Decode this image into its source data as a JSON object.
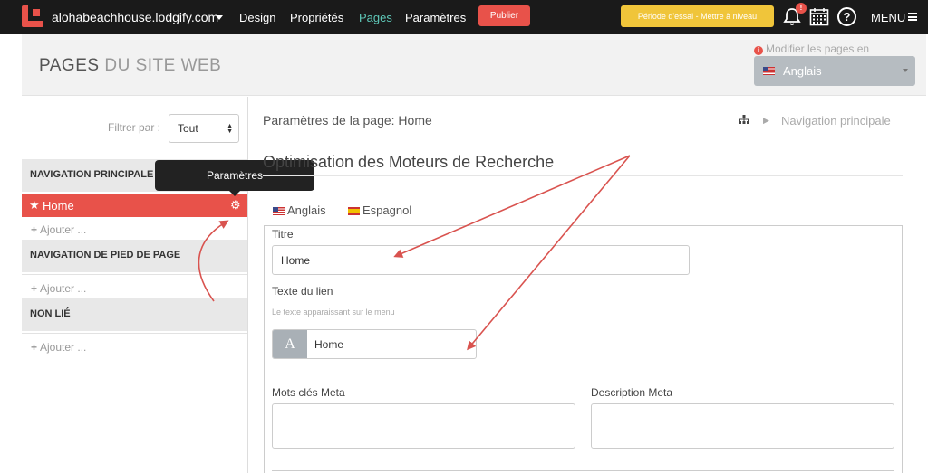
{
  "topbar": {
    "site_name": "alohabeachhouse.lodgify.com",
    "nav": [
      "Design",
      "Propriétés",
      "Pages",
      "Paramètres"
    ],
    "active_nav": "Pages",
    "publish_label": "Publier",
    "trial_label": "Période d'essai - Mettre à niveau",
    "notification_badge": "!",
    "help_glyph": "?",
    "menu_label": "MENU"
  },
  "header": {
    "title_strong": "PAGES",
    "title_light": " DU SITE WEB",
    "modify_label": "Modifier les pages en",
    "language": "Anglais"
  },
  "sidebar": {
    "filter_label": "Filtrer par :",
    "filter_value": "Tout",
    "sections": [
      {
        "title": "NAVIGATION PRINCIPALE",
        "items": [
          {
            "label": "Home"
          }
        ],
        "add_label": "Ajouter ..."
      },
      {
        "title": "NAVIGATION DE PIED DE PAGE",
        "items": [],
        "add_label": "Ajouter ..."
      },
      {
        "title": "NON LIÉ",
        "items": [],
        "add_label": "Ajouter ..."
      }
    ],
    "tooltip": "Paramètres"
  },
  "main": {
    "settings_title": "Paramètres de la page: Home",
    "breadcrumb": "Navigation principale",
    "seo_title": "Optimisation des Moteurs de Recherche",
    "languages": [
      "Anglais",
      "Espagnol"
    ],
    "form": {
      "title_label": "Titre",
      "title_value": "Home",
      "link_label": "Texte du lien",
      "link_hint": "Le texte apparaissant sur le menu",
      "link_addon": "A",
      "link_value": "Home",
      "keywords_label": "Mots clés Meta",
      "keywords_value": "",
      "description_label": "Description Meta",
      "description_value": ""
    }
  },
  "colors": {
    "accent_red": "#e8524a",
    "teal_active": "#5ec8b8",
    "trial_yellow": "#f0c53a",
    "topbar_bg": "#1a1a1a"
  }
}
